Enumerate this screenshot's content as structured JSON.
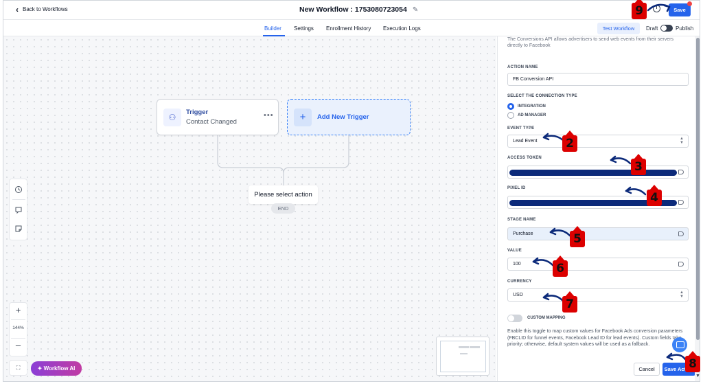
{
  "header": {
    "back_label": "Back to Workflows",
    "title": "New Workflow : 1753080723054",
    "save_label": "Save"
  },
  "tabs": [
    {
      "label": "Builder",
      "active": true
    },
    {
      "label": "Settings"
    },
    {
      "label": "Enrollment History"
    },
    {
      "label": "Execution Logs"
    }
  ],
  "toolbar_right": {
    "test_label": "Test Workflow",
    "draft_label": "Draft",
    "publish_label": "Publish",
    "published": false
  },
  "canvas": {
    "trigger": {
      "title": "Trigger",
      "subtitle": "Contact Changed"
    },
    "add_trigger_label": "Add New Trigger",
    "select_action_label": "Please select action",
    "end_label": "END",
    "zoom_level": "144%",
    "ai_label": "Workflow AI"
  },
  "panel": {
    "description": "The Conversions API allows advertisers to send web events from their servers directly to Facebook",
    "action_name": {
      "label": "ACTION NAME",
      "value": "FB Conversion API"
    },
    "connection": {
      "label": "SELECT THE CONNECTION TYPE",
      "options": [
        "INTEGRATION",
        "AD MANAGER"
      ],
      "selected": "INTEGRATION"
    },
    "event_type": {
      "label": "EVENT TYPE",
      "value": "Lead Event"
    },
    "access_token": {
      "label": "ACCESS TOKEN"
    },
    "pixel_id": {
      "label": "PIXEL ID"
    },
    "stage_name": {
      "label": "STAGE NAME",
      "value": "Purchase"
    },
    "value": {
      "label": "VALUE",
      "value": "100"
    },
    "currency": {
      "label": "CURRENCY",
      "value": "USD"
    },
    "custom_mapping": {
      "label": "CUSTOM MAPPING",
      "enabled": false
    },
    "help_text": "Enable this toggle to map custom values for Facebook Ads conversion parameters (FBCLID for funnel events, Facebook Lead ID for lead events). Custom fields take priority; otherwise, default system values will be used as a fallback.",
    "cancel_label": "Cancel",
    "save_action_label": "Save Action"
  },
  "annotations": [
    "2",
    "3",
    "4",
    "5",
    "6",
    "7",
    "8",
    "9"
  ],
  "colors": {
    "accent": "#2563eb",
    "badge": "#dc0000",
    "redaction": "#0c2a7a"
  }
}
